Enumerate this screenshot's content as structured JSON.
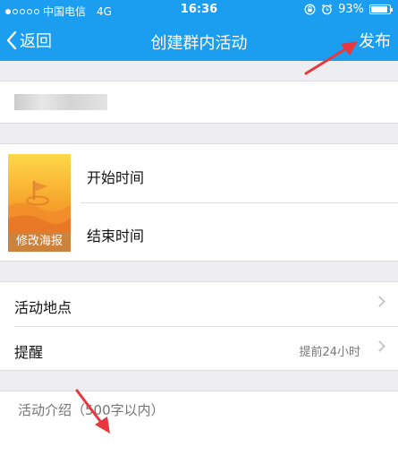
{
  "status": {
    "carrier": "中国电信",
    "network": "4G",
    "time": "16:36",
    "battery": "93%",
    "battery_level": 0.93,
    "signal_filled": 1,
    "signal_total": 5
  },
  "nav": {
    "back_label": "返回",
    "title": "创建群内活动",
    "publish_label": "发布"
  },
  "poster": {
    "label": "修改海报"
  },
  "time_rows": {
    "start": "开始时间",
    "end": "结束时间"
  },
  "location": {
    "label": "活动地点"
  },
  "reminder": {
    "label": "提醒",
    "value": "提前24小时"
  },
  "intro": {
    "placeholder": "活动介绍（500字以内）"
  },
  "colors": {
    "header_bg": "#1b9ef0",
    "page_bg": "#eeeef2",
    "arrow_red": "#e8383d"
  }
}
